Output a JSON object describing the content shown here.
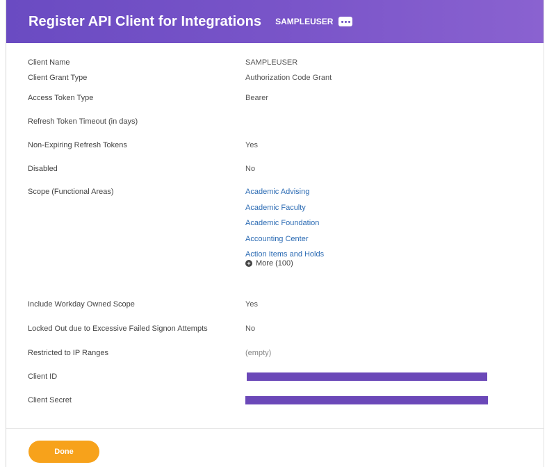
{
  "header": {
    "title": "Register API Client for Integrations",
    "user": "SAMPLEUSER"
  },
  "fields": [
    {
      "label": "Client Name",
      "value": "SAMPLEUSER"
    },
    {
      "label": "Client Grant Type",
      "value": "Authorization Code Grant"
    },
    {
      "label": "Access Token Type",
      "value": "Bearer"
    },
    {
      "label": "Refresh Token Timeout (in days)",
      "value": ""
    },
    {
      "label": "Non-Expiring Refresh Tokens",
      "value": "Yes"
    },
    {
      "label": "Disabled",
      "value": "No"
    },
    {
      "label": "Scope (Functional Areas)",
      "values": [
        "Academic Advising",
        "Academic Faculty",
        "Academic Foundation",
        "Accounting Center",
        "Action Items and Holds"
      ],
      "more": "More (100)"
    },
    {
      "label": "Include Workday Owned Scope",
      "value": "Yes"
    },
    {
      "label": "Locked Out due to Excessive Failed Signon Attempts",
      "value": "No"
    },
    {
      "label": "Restricted to IP Ranges",
      "value": "(empty)"
    },
    {
      "label": "Client ID",
      "value": "",
      "redacted": true
    },
    {
      "label": "Client Secret",
      "value": "",
      "redacted": true
    }
  ],
  "footer": {
    "done_label": "Done"
  },
  "colors": {
    "header": "#6a4bc2",
    "link": "#2a6ab3",
    "redaction": "#6b48b8",
    "button": "#f7a21b"
  }
}
